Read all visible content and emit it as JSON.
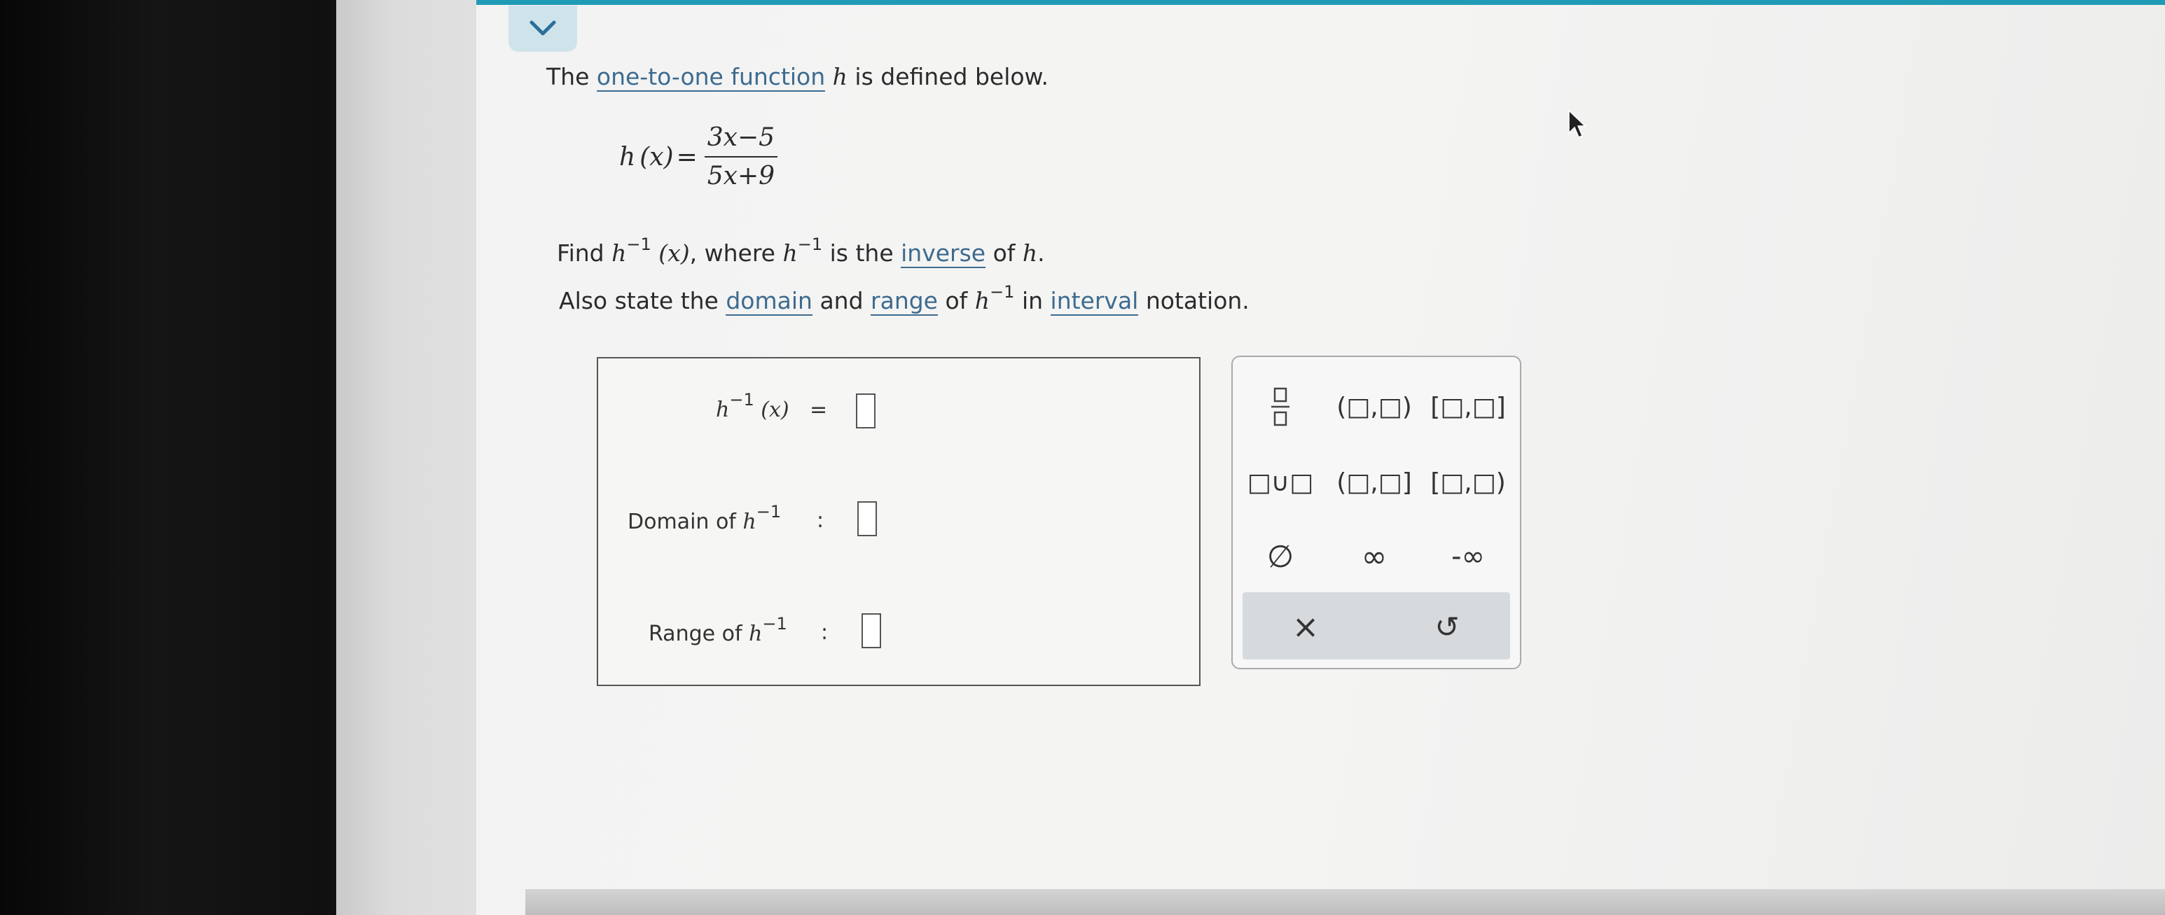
{
  "prompt": {
    "line1": {
      "pre": "The ",
      "link": "one-to-one function",
      "var": "h",
      "post": " is defined below."
    },
    "definition": {
      "lhs_fn": "h",
      "lhs_arg": "(x)",
      "equals": "=",
      "numerator": "3x−5",
      "denominator": "5x+9"
    },
    "line2": {
      "pre": "Find ",
      "fn": "h",
      "sup": "−1",
      "arg": "(x)",
      "mid": ", where ",
      "fn2": "h",
      "sup2": "−1",
      "mid2": " is the ",
      "link": "inverse",
      "mid3": " of ",
      "var": "h",
      "end": "."
    },
    "line3": {
      "pre": "Also state the ",
      "link1": "domain",
      "and": " and ",
      "link2": "range",
      "of": " of ",
      "fn": "h",
      "sup": "−1",
      "in": " in ",
      "link3": "interval",
      "post": " notation."
    }
  },
  "answers": {
    "inverse_row": {
      "fn": "h",
      "sup": "−1",
      "arg": "(x)",
      "sep": "="
    },
    "domain_row": {
      "label": "Domain of ",
      "fn": "h",
      "sup": "−1",
      "sep": ":"
    },
    "range_row": {
      "label": "Range of ",
      "fn": "h",
      "sup": "−1",
      "sep": ":"
    }
  },
  "palette": {
    "open_open": "(□,□)",
    "closed_closed": "[□,□]",
    "union": "□∪□",
    "open_closed": "(□,□]",
    "closed_open": "[□,□)",
    "empty_set": "∅",
    "infinity": "∞",
    "neg_infinity": "-∞",
    "clear": "×",
    "undo": "↺"
  },
  "colors": {
    "accent_bar": "#1f9bb6",
    "link": "#3d6b8f",
    "collapse_button": "#cfe3ea"
  }
}
